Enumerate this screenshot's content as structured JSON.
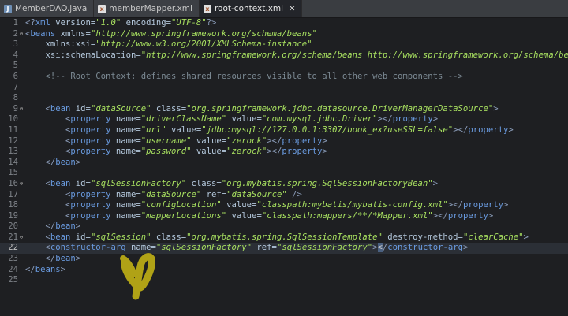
{
  "tabs": [
    {
      "label": "MemberDAO.java",
      "icon": "java-file-icon",
      "active": false,
      "glyph": "J"
    },
    {
      "label": "memberMapper.xml",
      "icon": "xml-file-icon",
      "active": false,
      "glyph": "x"
    },
    {
      "label": "root-context.xml",
      "icon": "xml-file-icon",
      "active": true,
      "glyph": "x"
    }
  ],
  "close_glyph": "✕",
  "colors": {
    "tag": "#6a9be0",
    "attr": "#b4c8dc",
    "value": "#a8e060",
    "comment": "#7c8a94",
    "annotation": "#b0a216"
  },
  "lines": [
    {
      "n": "1",
      "fold": "",
      "parts": [
        [
          "br",
          "<?"
        ],
        [
          "tag",
          "xml"
        ],
        [
          "attr",
          " version="
        ],
        [
          "val",
          "\"1.0\""
        ],
        [
          "attr",
          " encoding="
        ],
        [
          "val",
          "\"UTF-8\""
        ],
        [
          "br",
          "?>"
        ]
      ]
    },
    {
      "n": "2",
      "fold": "⊖",
      "parts": [
        [
          "br",
          "<"
        ],
        [
          "tag",
          "beans"
        ],
        [
          "attr",
          " xmlns="
        ],
        [
          "val",
          "\"http://www.springframework.org/schema/beans\""
        ]
      ]
    },
    {
      "n": "3",
      "fold": "",
      "parts": [
        [
          "plain",
          "    "
        ],
        [
          "attr",
          "xmlns:xsi="
        ],
        [
          "val",
          "\"http://www.w3.org/2001/XMLSchema-instance\""
        ]
      ]
    },
    {
      "n": "4",
      "fold": "",
      "parts": [
        [
          "plain",
          "    "
        ],
        [
          "attr",
          "xsi:schemaLocation="
        ],
        [
          "val",
          "\"http://www.springframework.org/schema/beans http://www.springframework.org/schema/bean"
        ]
      ]
    },
    {
      "n": "5",
      "fold": "",
      "parts": []
    },
    {
      "n": "6",
      "fold": "",
      "parts": [
        [
          "plain",
          "    "
        ],
        [
          "comment",
          "<!-- Root Context: defines shared resources visible to all other web components -->"
        ]
      ]
    },
    {
      "n": "7",
      "fold": "",
      "parts": []
    },
    {
      "n": "8",
      "fold": "",
      "parts": []
    },
    {
      "n": "9",
      "fold": "⊖",
      "parts": [
        [
          "plain",
          "    "
        ],
        [
          "br",
          "<"
        ],
        [
          "tag",
          "bean"
        ],
        [
          "attr",
          " id="
        ],
        [
          "val",
          "\"dataSource\""
        ],
        [
          "attr",
          " class="
        ],
        [
          "val",
          "\"org.springframework.jdbc.datasource.DriverManagerDataSource\""
        ],
        [
          "br",
          ">"
        ]
      ]
    },
    {
      "n": "10",
      "fold": "",
      "parts": [
        [
          "plain",
          "        "
        ],
        [
          "br",
          "<"
        ],
        [
          "tag",
          "property"
        ],
        [
          "attr",
          " name="
        ],
        [
          "val",
          "\"driverClassName\""
        ],
        [
          "attr",
          " value="
        ],
        [
          "val",
          "\"com.mysql.jdbc.Driver\""
        ],
        [
          "br",
          ">"
        ],
        [
          "br",
          "</"
        ],
        [
          "tag",
          "property"
        ],
        [
          "br",
          ">"
        ]
      ]
    },
    {
      "n": "11",
      "fold": "",
      "parts": [
        [
          "plain",
          "        "
        ],
        [
          "br",
          "<"
        ],
        [
          "tag",
          "property"
        ],
        [
          "attr",
          " name="
        ],
        [
          "val",
          "\"url\""
        ],
        [
          "attr",
          " value="
        ],
        [
          "val",
          "\"jdbc:mysql://127.0.0.1:3307/book_ex?useSSL=false\""
        ],
        [
          "br",
          ">"
        ],
        [
          "br",
          "</"
        ],
        [
          "tag",
          "property"
        ],
        [
          "br",
          ">"
        ]
      ]
    },
    {
      "n": "12",
      "fold": "",
      "parts": [
        [
          "plain",
          "        "
        ],
        [
          "br",
          "<"
        ],
        [
          "tag",
          "property"
        ],
        [
          "attr",
          " name="
        ],
        [
          "val",
          "\"username\""
        ],
        [
          "attr",
          " value="
        ],
        [
          "val",
          "\"zerock\""
        ],
        [
          "br",
          ">"
        ],
        [
          "br",
          "</"
        ],
        [
          "tag",
          "property"
        ],
        [
          "br",
          ">"
        ]
      ]
    },
    {
      "n": "13",
      "fold": "",
      "parts": [
        [
          "plain",
          "        "
        ],
        [
          "br",
          "<"
        ],
        [
          "tag",
          "property"
        ],
        [
          "attr",
          " name="
        ],
        [
          "val",
          "\"password\""
        ],
        [
          "attr",
          " value="
        ],
        [
          "val",
          "\"zerock\""
        ],
        [
          "br",
          ">"
        ],
        [
          "br",
          "</"
        ],
        [
          "tag",
          "property"
        ],
        [
          "br",
          ">"
        ]
      ]
    },
    {
      "n": "14",
      "fold": "",
      "parts": [
        [
          "plain",
          "    "
        ],
        [
          "br",
          "</"
        ],
        [
          "tag",
          "bean"
        ],
        [
          "br",
          ">"
        ]
      ]
    },
    {
      "n": "15",
      "fold": "",
      "parts": []
    },
    {
      "n": "16",
      "fold": "⊖",
      "parts": [
        [
          "plain",
          "    "
        ],
        [
          "br",
          "<"
        ],
        [
          "tag",
          "bean"
        ],
        [
          "attr",
          " id="
        ],
        [
          "val",
          "\"sqlSessionFactory\""
        ],
        [
          "attr",
          " class="
        ],
        [
          "val",
          "\"org.mybatis.spring.SqlSessionFactoryBean\""
        ],
        [
          "br",
          ">"
        ]
      ]
    },
    {
      "n": "17",
      "fold": "",
      "parts": [
        [
          "plain",
          "        "
        ],
        [
          "br",
          "<"
        ],
        [
          "tag",
          "property"
        ],
        [
          "attr",
          " name="
        ],
        [
          "val",
          "\"dataSource\""
        ],
        [
          "attr",
          " ref="
        ],
        [
          "val",
          "\"dataSource\""
        ],
        [
          "br",
          " />"
        ]
      ]
    },
    {
      "n": "18",
      "fold": "",
      "parts": [
        [
          "plain",
          "        "
        ],
        [
          "br",
          "<"
        ],
        [
          "tag",
          "property"
        ],
        [
          "attr",
          " name="
        ],
        [
          "val",
          "\"configLocation\""
        ],
        [
          "attr",
          " value="
        ],
        [
          "val",
          "\"classpath:mybatis/mybatis-config.xml\""
        ],
        [
          "br",
          ">"
        ],
        [
          "br",
          "</"
        ],
        [
          "tag",
          "property"
        ],
        [
          "br",
          ">"
        ]
      ]
    },
    {
      "n": "19",
      "fold": "",
      "parts": [
        [
          "plain",
          "        "
        ],
        [
          "br",
          "<"
        ],
        [
          "tag",
          "property"
        ],
        [
          "attr",
          " name="
        ],
        [
          "val",
          "\"mapperLocations\""
        ],
        [
          "attr",
          " value="
        ],
        [
          "val",
          "\"classpath:mappers/**/*Mapper.xml\""
        ],
        [
          "br",
          ">"
        ],
        [
          "br",
          "</"
        ],
        [
          "tag",
          "property"
        ],
        [
          "br",
          ">"
        ]
      ]
    },
    {
      "n": "20",
      "fold": "",
      "parts": [
        [
          "plain",
          "    "
        ],
        [
          "br",
          "</"
        ],
        [
          "tag",
          "bean"
        ],
        [
          "br",
          ">"
        ]
      ]
    },
    {
      "n": "21",
      "fold": "⊖",
      "parts": [
        [
          "plain",
          "    "
        ],
        [
          "br",
          "<"
        ],
        [
          "tag",
          "bean"
        ],
        [
          "attr",
          " id="
        ],
        [
          "val",
          "\"sqlSession\""
        ],
        [
          "attr",
          " class="
        ],
        [
          "val",
          "\"org.mybatis.spring.SqlSessionTemplate\""
        ],
        [
          "attr",
          " destroy-method="
        ],
        [
          "val",
          "\"clearCache\""
        ],
        [
          "br",
          ">"
        ]
      ]
    },
    {
      "n": "22",
      "fold": "",
      "current": true,
      "parts": [
        [
          "plain",
          "    "
        ],
        [
          "br",
          "<"
        ],
        [
          "tag",
          "constructor-arg"
        ],
        [
          "attr",
          " name="
        ],
        [
          "val",
          "\"sqlSessionFactory\""
        ],
        [
          "attr",
          " ref="
        ],
        [
          "val",
          "\"sqlSessionFactory\""
        ],
        [
          "br",
          ">"
        ],
        [
          "hl",
          "<"
        ],
        [
          "br",
          "/"
        ],
        [
          "tag",
          "constructor-arg"
        ],
        [
          "br",
          ">"
        ]
      ]
    },
    {
      "n": "23",
      "fold": "",
      "parts": [
        [
          "plain",
          "    "
        ],
        [
          "br",
          "</"
        ],
        [
          "tag",
          "bean"
        ],
        [
          "br",
          ">"
        ]
      ]
    },
    {
      "n": "24",
      "fold": "",
      "parts": [
        [
          "br",
          "</"
        ],
        [
          "tag",
          "beans"
        ],
        [
          "br",
          ">"
        ]
      ]
    },
    {
      "n": "25",
      "fold": "",
      "parts": []
    }
  ]
}
